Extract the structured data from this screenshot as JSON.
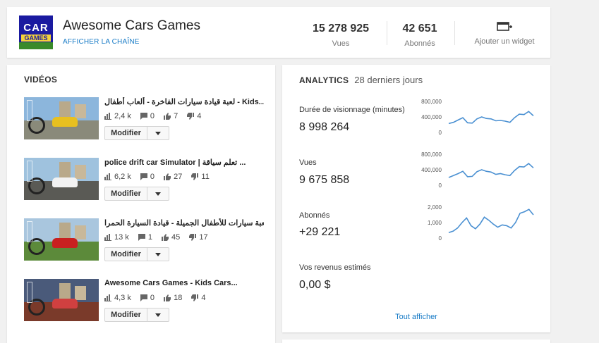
{
  "channel": {
    "avatar_text_top": "CAR",
    "avatar_text_bottom": "GAMES",
    "name": "Awesome Cars Games",
    "view_channel_link": "AFFICHER LA CHAÎNE",
    "stats": {
      "views_value": "15 278 925",
      "views_label": "Vues",
      "subscribers_value": "42 651",
      "subscribers_label": "Abonnés"
    },
    "add_widget_label": "Ajouter un widget",
    "add_widget_icon": "add-widget-icon"
  },
  "videos": {
    "title": "VIDÉOS",
    "edit_label": "Modifier",
    "items": [
      {
        "title": "لعبة قيادة سيارات الفاخرة - ألعاب أطفال - Kids...",
        "views": "2,4 k",
        "comments": "0",
        "likes": "7",
        "dislikes": "4",
        "theme": "city"
      },
      {
        "title": "police drift car Simulator | تعلم سياقة ...",
        "views": "6,2 k",
        "comments": "0",
        "likes": "27",
        "dislikes": "11",
        "theme": "police"
      },
      {
        "title": "لعبة سيارات للأطفال الجميلة - قيادة السيارة الحمرا...",
        "views": "13 k",
        "comments": "1",
        "likes": "45",
        "dislikes": "17",
        "theme": "red"
      },
      {
        "title": "Awesome Cars Games - Kids Cars...",
        "views": "4,3 k",
        "comments": "0",
        "likes": "18",
        "dislikes": "4",
        "theme": "night"
      }
    ]
  },
  "analytics": {
    "title": "ANALYTICS",
    "period": "28 derniers jours",
    "metrics": [
      {
        "label": "Durée de visionnage (minutes)",
        "value": "8 998 264",
        "axis": [
          "800,000",
          "400,000",
          "0"
        ],
        "ymax": 800000
      },
      {
        "label": "Vues",
        "value": "9 675 858",
        "axis": [
          "800,000",
          "400,000",
          "0"
        ],
        "ymax": 800000
      },
      {
        "label": "Abonnés",
        "value": "+29 221",
        "axis": [
          "2,000",
          "1,000",
          "0"
        ],
        "ymax": 2000
      },
      {
        "label": "Vos revenus estimés",
        "value": "0,00 $"
      }
    ],
    "see_all": "Tout afficher",
    "line_color": "#4a90d2"
  },
  "chart_data": [
    {
      "type": "line",
      "series": [
        {
          "values": [
            230000,
            260000,
            320000,
            380000,
            250000,
            240000,
            350000,
            400000,
            360000,
            350000,
            300000,
            310000,
            290000,
            260000,
            380000,
            470000,
            460000,
            540000,
            430000
          ]
        }
      ],
      "ylim": [
        0,
        800000
      ]
    },
    {
      "type": "line",
      "series": [
        {
          "values": [
            200000,
            250000,
            300000,
            360000,
            220000,
            230000,
            350000,
            400000,
            360000,
            340000,
            280000,
            300000,
            270000,
            250000,
            380000,
            480000,
            470000,
            560000,
            450000
          ]
        }
      ],
      "ylim": [
        0,
        800000
      ]
    },
    {
      "type": "line",
      "series": [
        {
          "values": [
            350,
            450,
            650,
            1000,
            1300,
            800,
            600,
            900,
            1350,
            1150,
            900,
            700,
            850,
            800,
            650,
            1000,
            1600,
            1700,
            1850,
            1500
          ]
        }
      ],
      "ylim": [
        0,
        2000
      ]
    }
  ]
}
